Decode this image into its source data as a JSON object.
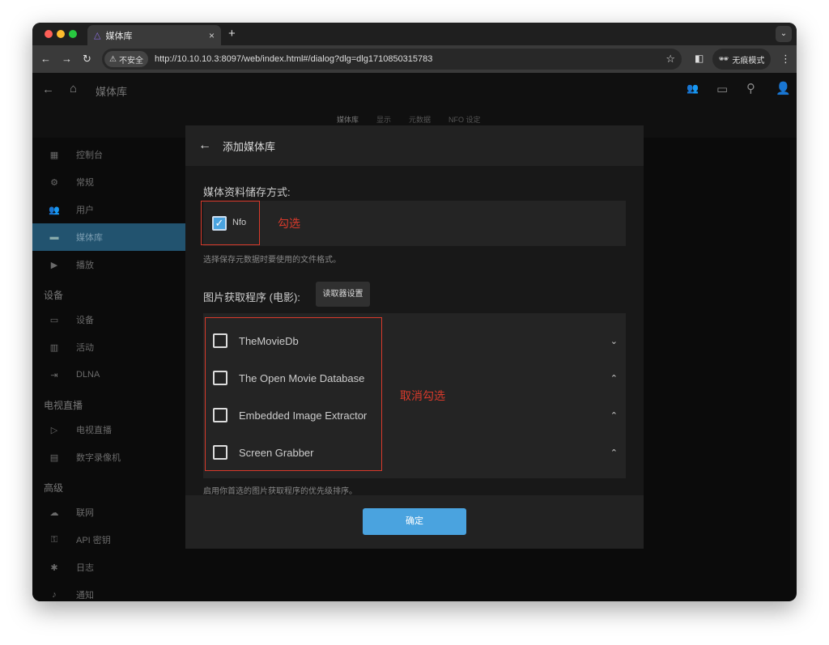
{
  "browser": {
    "tab_title": "媒体库",
    "security": "不安全",
    "url": "http://10.10.10.3:8097/web/index.html#/dialog?dlg=dlg1710850315783",
    "incognito": "无痕模式"
  },
  "app": {
    "title": "媒体库",
    "subtabs": [
      "媒体库",
      "显示",
      "元数据",
      "NFO 设定"
    ]
  },
  "sidebar": {
    "items": [
      {
        "icon": "dashboard-icon",
        "label": "控制台"
      },
      {
        "icon": "gear-icon",
        "label": "常规"
      },
      {
        "icon": "users-icon",
        "label": "用户"
      },
      {
        "icon": "folder-icon",
        "label": "媒体库",
        "active": true
      },
      {
        "icon": "play-icon",
        "label": "播放"
      }
    ],
    "sections": [
      {
        "title": "设备",
        "items": [
          {
            "icon": "devices-icon",
            "label": "设备"
          },
          {
            "icon": "activity-icon",
            "label": "活动"
          },
          {
            "icon": "input-icon",
            "label": "DLNA"
          }
        ]
      },
      {
        "title": "电视直播",
        "items": [
          {
            "icon": "tv-icon",
            "label": "电视直播"
          },
          {
            "icon": "dvr-icon",
            "label": "数字录像机"
          }
        ]
      },
      {
        "title": "高级",
        "items": [
          {
            "icon": "cloud-icon",
            "label": "联网"
          },
          {
            "icon": "key-icon",
            "label": "API 密钥"
          },
          {
            "icon": "bug-icon",
            "label": "日志"
          },
          {
            "icon": "bell-icon",
            "label": "通知"
          }
        ]
      }
    ]
  },
  "dialog": {
    "title": "添加媒体库",
    "metadata_label": "媒体资料储存方式:",
    "nfo": {
      "label": "Nfo",
      "checked": true
    },
    "nfo_annotation": "勾选",
    "metadata_hint": "选择保存元数据时要使用的文件格式。",
    "fetchers_label": "图片获取程序 (电影):",
    "fetcher_settings": "读取器设置",
    "fetchers": [
      {
        "label": "TheMovieDb",
        "checked": false,
        "chevron": "down"
      },
      {
        "label": "The Open Movie Database",
        "checked": false,
        "chevron": "up"
      },
      {
        "label": "Embedded Image Extractor",
        "checked": false,
        "chevron": "up"
      },
      {
        "label": "Screen Grabber",
        "checked": false,
        "chevron": "up"
      }
    ],
    "fetchers_annotation": "取消勾选",
    "fetchers_hint": "启用你首选的图片获取程序的优先级排序。",
    "ok": "确定"
  },
  "colors": {
    "accent": "#4aa3df",
    "annotation": "#d93a2b",
    "active_nav": "#22536f"
  }
}
